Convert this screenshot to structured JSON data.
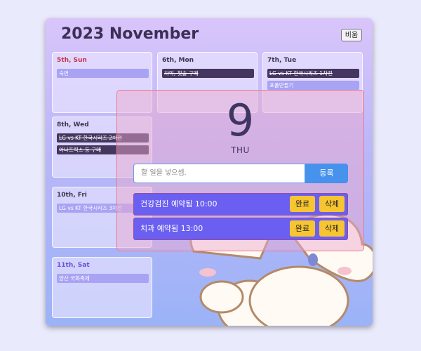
{
  "calendar": {
    "title": "2023 November",
    "hide_label": "비움",
    "days": [
      {
        "label": "5th, Sun",
        "color": "#c5334e",
        "tasks": [
          {
            "text": "숙면",
            "done": false
          }
        ]
      },
      {
        "label": "6th, Mon",
        "color": "#3b3550",
        "tasks": [
          {
            "text": "차악, 첫솔 구매",
            "done": true
          }
        ]
      },
      {
        "label": "7th, Tue",
        "color": "#3b3550",
        "tasks": [
          {
            "text": "LG vs KT 한국시리즈 1차전",
            "done": true
          },
          {
            "text": "포폴만들기",
            "done": false
          }
        ]
      },
      {
        "label": "8th, Wed",
        "color": "#3b3550",
        "tasks": [
          {
            "text": "LG vs KT 한국시리즈 2차전",
            "done": true
          },
          {
            "text": "아나프릭스 등 구매",
            "done": true
          }
        ]
      },
      {
        "label": "10th, Fri",
        "color": "#3b3550",
        "tasks": [
          {
            "text": "LG vs KT 한국시리즈 3차전",
            "done": false
          }
        ]
      },
      {
        "label": "11th, Sat",
        "color": "#6a4fd8",
        "tasks": [
          {
            "text": "양산 국화축제",
            "done": false
          }
        ]
      }
    ]
  },
  "modal": {
    "day": "9",
    "weekday": "THU",
    "input_placeholder": "할 일을 넣으셈.",
    "add_label": "등록",
    "todos": [
      {
        "text": "건강검진 예약됨 10:00",
        "complete_label": "완료",
        "delete_label": "삭제"
      },
      {
        "text": "치과 예약됨 13:00",
        "complete_label": "완료",
        "delete_label": "삭제"
      }
    ]
  },
  "colors": {
    "accent": "#4692ec",
    "todo_bg": "#6a5ff0",
    "todo_button": "#f7c531",
    "modal_border": "#e87a8f"
  },
  "icons": {
    "character": "puppy-character-illustration"
  }
}
